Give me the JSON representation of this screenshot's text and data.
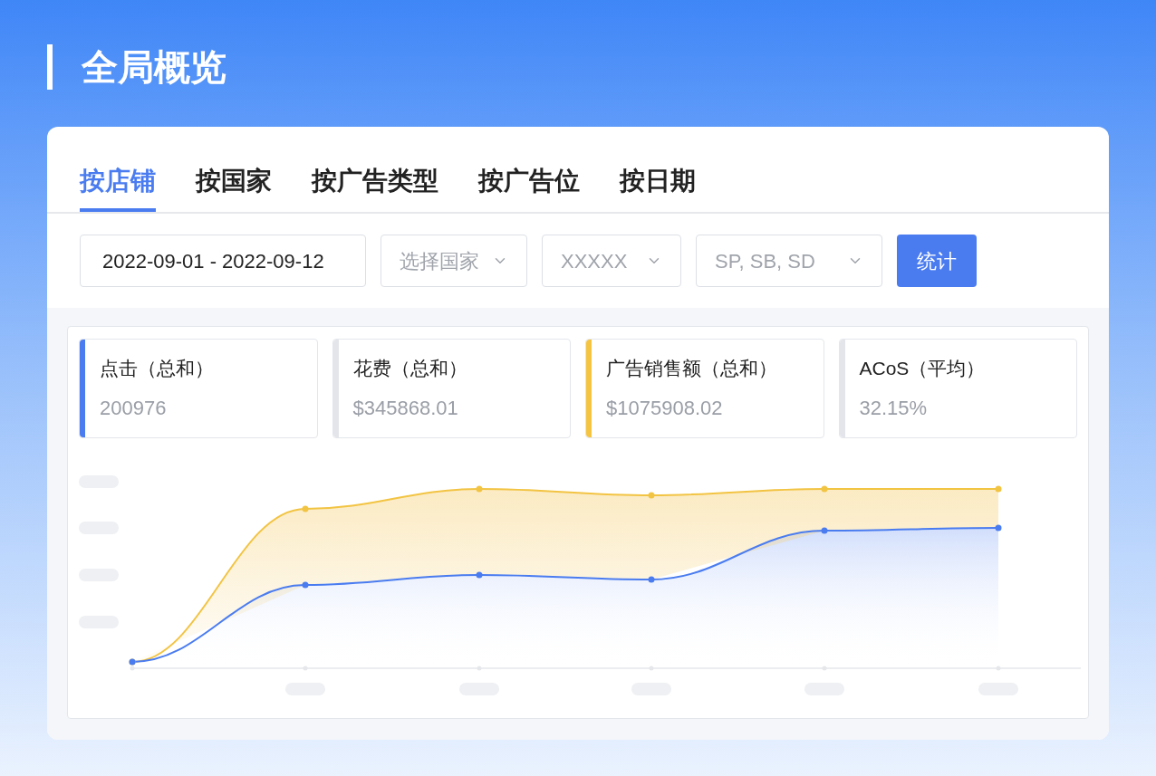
{
  "page": {
    "title": "全局概览"
  },
  "tabs": [
    {
      "label": "按店铺",
      "selected": true
    },
    {
      "label": "按国家",
      "selected": false
    },
    {
      "label": "按广告类型",
      "selected": false
    },
    {
      "label": "按广告位",
      "selected": false
    },
    {
      "label": "按日期",
      "selected": false
    }
  ],
  "filters": {
    "date_range": "2022-09-01 - 2022-09-12",
    "selects": [
      {
        "placeholder": "选择国家"
      },
      {
        "value": "XXXXX"
      },
      {
        "value": "SP, SB, SD"
      }
    ],
    "submit": "统计"
  },
  "stats": [
    {
      "label": "点击（总和）",
      "value": "200976",
      "color": "#4a7cf0"
    },
    {
      "label": "花费（总和）",
      "value": "$345868.01",
      "color": "#e3e5ea"
    },
    {
      "label": "广告销售额（总和）",
      "value": "$1075908.02",
      "color": "#f5c542"
    },
    {
      "label": "ACoS（平均）",
      "value": "32.15%",
      "color": "#e3e5ea"
    }
  ]
}
